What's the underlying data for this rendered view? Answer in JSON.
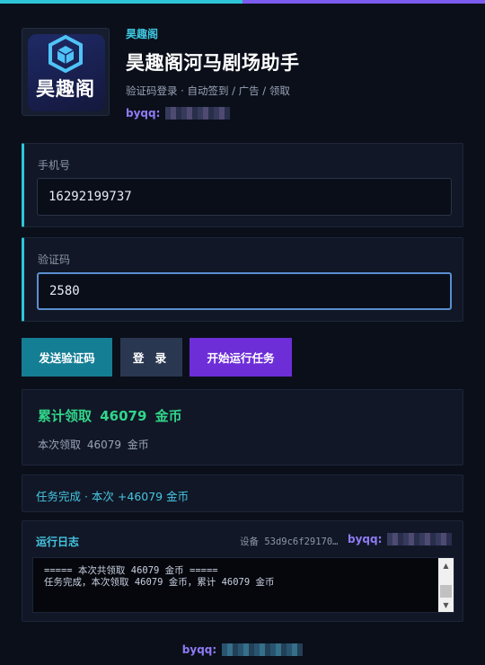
{
  "header": {
    "subtitle": "昊趣阁",
    "title": "昊趣阁河马剧场助手",
    "description": "验证码登录 · 自动签到 / 广告 / 领取",
    "byqq_label": "byqq:",
    "logo_text": "昊趣阁",
    "logo_icon": "cube-icon"
  },
  "form": {
    "phone": {
      "label": "手机号",
      "value": "16292199737"
    },
    "code": {
      "label": "验证码",
      "value": "2580"
    }
  },
  "buttons": {
    "send_code": "发送验证码",
    "login": "登 录",
    "start_task": "开始运行任务"
  },
  "stats": {
    "total": "累计领取  46079  金币",
    "current": "本次领取  46079  金币"
  },
  "status": {
    "text": "任务完成 · 本次 +46079 金币"
  },
  "log": {
    "title": "运行日志",
    "device": "设备 53d9c6f29170…",
    "byqq_label": "byqq:",
    "lines": "===== 本次共领取 46079 金币 =====\n任务完成，本次领取 46079 金币，累计 46079 金币"
  },
  "footer": {
    "byqq_label": "byqq:"
  },
  "colors": {
    "accent_cyan": "#2ec5d8",
    "accent_purple": "#7c5cf0",
    "success_green": "#31d58a",
    "send_button": "#147e95",
    "login_button": "#2a3750",
    "run_button": "#6d2ed8"
  }
}
